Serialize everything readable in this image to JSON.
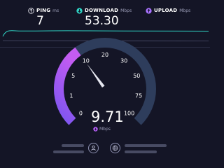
{
  "metrics": {
    "ping": {
      "label": "PING",
      "unit": "ms",
      "value": "7",
      "icon": "ping-icon"
    },
    "download": {
      "label": "DOWNLOAD",
      "unit": "Mbps",
      "value": "53.30",
      "icon": "download-icon"
    },
    "upload": {
      "label": "UPLOAD",
      "unit": "Mbps",
      "value": "",
      "icon": "upload-icon"
    }
  },
  "gauge": {
    "scale_labels": [
      "0",
      "1",
      "5",
      "10",
      "20",
      "30",
      "50",
      "75",
      "100"
    ],
    "current_speed": "9.71",
    "unit": "Mbps",
    "needle_value": 9.71
  },
  "colors": {
    "background": "#141526",
    "download_accent": "#2fd3c4",
    "upload_accent": "#a972ff",
    "gauge_active": "#b15cf0",
    "gauge_track": "#2e3d5c"
  },
  "footer": {
    "user_icon": "user-icon",
    "globe_icon": "globe-icon"
  }
}
